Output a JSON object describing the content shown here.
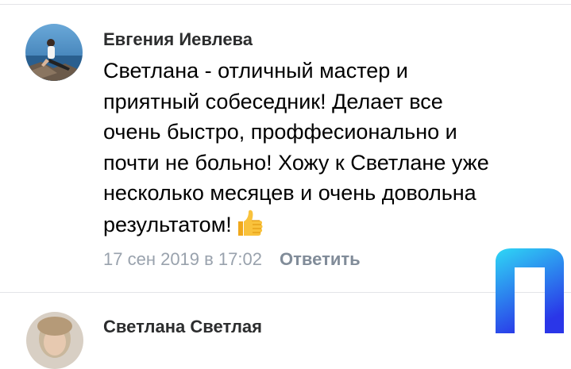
{
  "comments": [
    {
      "author": "Евгения Иевлева",
      "text_lines": [
        "Светлана - отличный мастер и",
        "приятный собеседник! Делает все",
        "очень быстро, проффесионально и",
        "почти не больно! Хожу к Светлане уже",
        "несколько месяцев и очень довольна",
        "результатом!"
      ],
      "emoji": "thumbs-up-icon",
      "date": "17 сен 2019 в 17:02",
      "reply_label": "Ответить"
    },
    {
      "author": "Светлана Светлая"
    }
  ],
  "colors": {
    "author": "#2c2d2e",
    "meta": "#99a2ad",
    "reply": "#818c99",
    "divider": "#e3e4e8",
    "logo_gradient_top": "#2fd8f5",
    "logo_gradient_bottom": "#2a36e8"
  }
}
